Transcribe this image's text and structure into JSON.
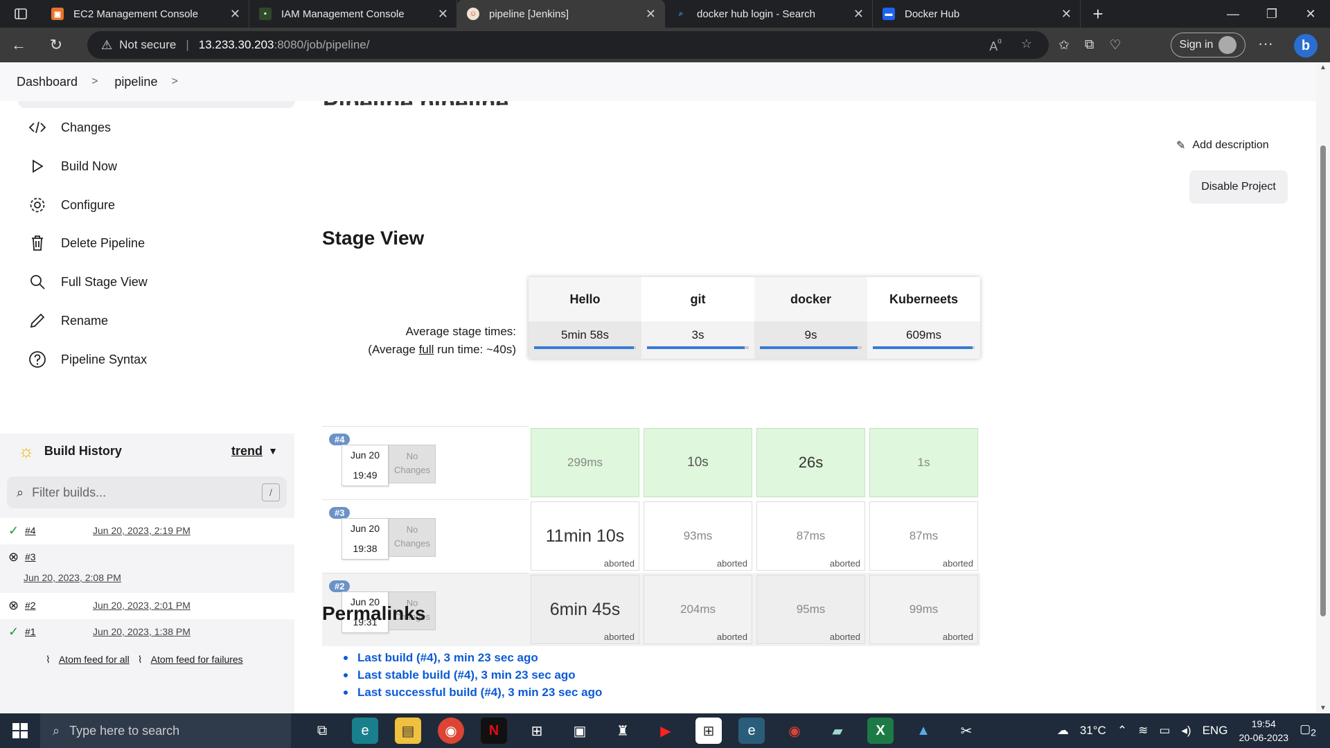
{
  "browser": {
    "tabs": [
      {
        "title": "EC2 Management Console",
        "favicon": "aws-icon",
        "color": "#e8742a",
        "active": false
      },
      {
        "title": "IAM Management Console",
        "favicon": "aws-icon",
        "color": "#2e4a2a",
        "active": false
      },
      {
        "title": "pipeline [Jenkins]",
        "favicon": "jenkins-icon",
        "color": "#d24939",
        "active": true
      },
      {
        "title": "docker hub login - Search",
        "favicon": "bing-search-icon",
        "color": "#2a6ed0",
        "active": false
      },
      {
        "title": "Docker Hub",
        "favicon": "docker-icon",
        "color": "#1d63ed",
        "active": false
      }
    ],
    "security_label": "Not secure",
    "url_host": "13.233.30.203",
    "url_rest": ":8080/job/pipeline/",
    "signin_label": "Sign in"
  },
  "breadcrumb": {
    "dashboard": "Dashboard",
    "pipeline": "pipeline"
  },
  "page_title": "Pipeline pipeline",
  "sidebar": {
    "items": [
      {
        "label": "Changes",
        "icon": "code-icon"
      },
      {
        "label": "Build Now",
        "icon": "play-icon"
      },
      {
        "label": "Configure",
        "icon": "gear-icon"
      },
      {
        "label": "Delete Pipeline",
        "icon": "trash-icon"
      },
      {
        "label": "Full Stage View",
        "icon": "search-icon"
      },
      {
        "label": "Rename",
        "icon": "pencil-icon"
      },
      {
        "label": "Pipeline Syntax",
        "icon": "help-icon"
      }
    ]
  },
  "build_history": {
    "title": "Build History",
    "trend": "trend",
    "filter_placeholder": "Filter builds...",
    "filter_shortcut": "/",
    "builds": [
      {
        "number": "#4",
        "date": "Jun 20, 2023, 2:19 PM",
        "status": "success"
      },
      {
        "number": "#3",
        "date": "Jun 20, 2023, 2:08 PM",
        "status": "aborted"
      },
      {
        "number": "#2",
        "date": "Jun 20, 2023, 2:01 PM",
        "status": "aborted"
      },
      {
        "number": "#1",
        "date": "Jun 20, 2023, 1:38 PM",
        "status": "success"
      }
    ],
    "atom_all": "Atom feed for all",
    "atom_failures": "Atom feed for failures"
  },
  "actions": {
    "add_description": "Add description",
    "disable_project": "Disable Project"
  },
  "stage_view": {
    "heading": "Stage View",
    "avg_label": "Average stage times:",
    "avg_full_prefix": "(Average ",
    "avg_full_word": "full",
    "avg_full_suffix": " run time: ~40s)",
    "stages": [
      "Hello",
      "git",
      "docker",
      "Kuberneets"
    ],
    "averages": [
      "5min 58s",
      "3s",
      "9s",
      "609ms"
    ],
    "avg_progress": [
      0.98,
      0.96,
      0.96,
      0.98
    ],
    "runs": [
      {
        "badge": "#4",
        "date": "Jun 20",
        "time": "19:49",
        "changes": "No Changes",
        "cells": [
          {
            "value": "299ms",
            "state": "success",
            "note": ""
          },
          {
            "value": "10s",
            "state": "success",
            "note": ""
          },
          {
            "value": "26s",
            "state": "success",
            "note": ""
          },
          {
            "value": "1s",
            "state": "success",
            "note": ""
          }
        ]
      },
      {
        "badge": "#3",
        "date": "Jun 20",
        "time": "19:38",
        "changes": "No Changes",
        "cells": [
          {
            "value": "11min 10s",
            "state": "aborted",
            "note": "aborted"
          },
          {
            "value": "93ms",
            "state": "aborted",
            "note": "aborted"
          },
          {
            "value": "87ms",
            "state": "aborted",
            "note": "aborted"
          },
          {
            "value": "87ms",
            "state": "aborted",
            "note": "aborted"
          }
        ]
      },
      {
        "badge": "#2",
        "date": "Jun 20",
        "time": "19:31",
        "changes": "No Changes",
        "cells": [
          {
            "value": "6min 45s",
            "state": "aborted",
            "note": "aborted"
          },
          {
            "value": "204ms",
            "state": "aborted",
            "note": "aborted"
          },
          {
            "value": "95ms",
            "state": "aborted",
            "note": "aborted"
          },
          {
            "value": "99ms",
            "state": "aborted",
            "note": "aborted"
          }
        ]
      }
    ]
  },
  "permalinks": {
    "heading": "Permalinks",
    "links": [
      "Last build (#4), 3 min 23 sec ago",
      "Last stable build (#4), 3 min 23 sec ago",
      "Last successful build (#4), 3 min 23 sec ago"
    ]
  },
  "taskbar": {
    "search_placeholder": "Type here to search",
    "weather": "31°C",
    "lang": "ENG",
    "time": "19:54",
    "date": "20-06-2023",
    "notifications": "2"
  },
  "colors": {
    "success_cell": "#dff7dc",
    "link": "#0b5ad6",
    "progress": "#3a7bd5"
  }
}
